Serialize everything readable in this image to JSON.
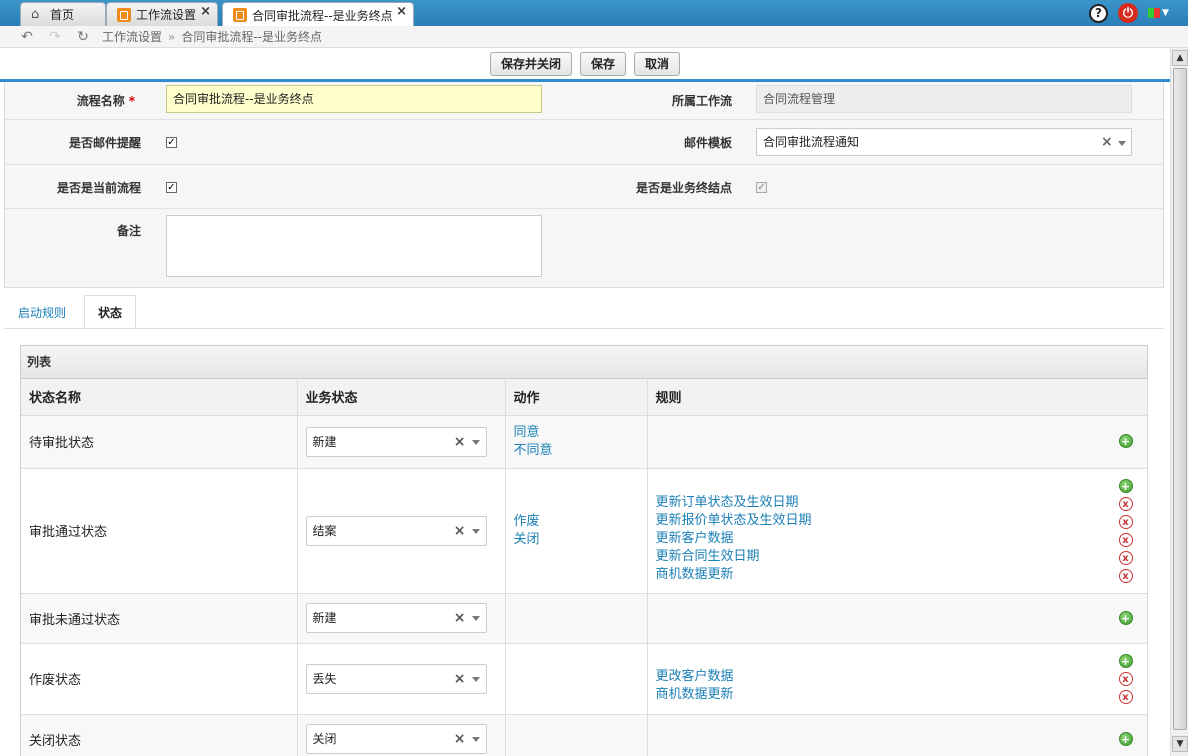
{
  "tabs": [
    {
      "label": "首页"
    },
    {
      "label": "工作流设置"
    },
    {
      "label": "合同审批流程--是业务终点"
    }
  ],
  "breadcrumb": [
    "工作流设置",
    "合同审批流程--是业务终点"
  ],
  "toolbar": {
    "save_close": "保存并关闭",
    "save": "保存",
    "cancel": "取消"
  },
  "form": {
    "name_label": "流程名称",
    "name_required": "*",
    "name_value": "合同审批流程--是业务终点",
    "workflow_label": "所属工作流",
    "workflow_value": "合同流程管理",
    "email_remind_label": "是否邮件提醒",
    "email_template_label": "邮件模板",
    "email_template_value": "合同审批流程通知",
    "current_flow_label": "是否是当前流程",
    "business_end_label": "是否是业务终结点",
    "note_label": "备注"
  },
  "ptabs": {
    "start_rules": "启动规则",
    "status": "状态"
  },
  "grid": {
    "title": "列表",
    "headers": [
      "状态名称",
      "业务状态",
      "动作",
      "规则"
    ],
    "rows": [
      {
        "name": "待审批状态",
        "status": "新建",
        "actions": [
          "同意",
          "不同意"
        ],
        "rules": []
      },
      {
        "name": "审批通过状态",
        "status": "结案",
        "actions": [
          "作废",
          "关闭"
        ],
        "rules": [
          "更新订单状态及生效日期",
          "更新报价单状态及生效日期",
          "更新客户数据",
          "更新合同生效日期",
          "商机数据更新"
        ]
      },
      {
        "name": "审批未通过状态",
        "status": "新建",
        "actions": [],
        "rules": []
      },
      {
        "name": "作废状态",
        "status": "丢失",
        "actions": [],
        "rules": [
          "更改客户数据",
          "商机数据更新"
        ]
      },
      {
        "name": "关闭状态",
        "status": "关闭",
        "actions": [],
        "rules": []
      }
    ]
  },
  "icons": {
    "add": "+",
    "delete": "x",
    "clear": "×"
  }
}
